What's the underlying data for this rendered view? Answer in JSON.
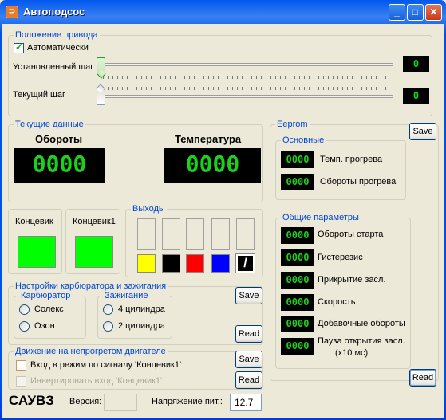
{
  "window": {
    "title": "Автоподсос",
    "app_icon": "pump-icon"
  },
  "titlebar_buttons": {
    "minimize": "_",
    "maximize": "□",
    "close": "✕"
  },
  "drive": {
    "legend": "Положение привода",
    "auto_label": "Автоматически",
    "auto_checked": true,
    "set_step_label": "Установленный шаг",
    "set_step_value": "0",
    "current_step_label": "Текущий шаг",
    "current_step_value": "0"
  },
  "current_data": {
    "legend": "Текущие данные",
    "rpm_label": "Обороты",
    "rpm_value": "0000",
    "temp_label": "Температура",
    "temp_value": "0000"
  },
  "limit_switch": {
    "label": "Концевик",
    "color": "#00ff00"
  },
  "limit_switch1": {
    "label": "Концевик1",
    "color": "#00ff00"
  },
  "outputs": {
    "legend": "Выходы",
    "colors": [
      "#ffff00",
      "#000000",
      "#ff0000",
      "#0000ff",
      "#000000"
    ],
    "last_symbol": "/"
  },
  "carb": {
    "legend": "Настройки карбюратора и зажигания",
    "carb_legend": "Карбюратор",
    "carb_options": [
      "Солекс",
      "Озон"
    ],
    "ign_legend": "Зажигание",
    "ign_options": [
      "4 цилиндра",
      "2 цилиндра"
    ],
    "save_label": "Save",
    "read_label": "Read"
  },
  "cold": {
    "legend": "Движение на непрогретом двигателе",
    "enter_mode_label": "Вход в режим по сигналу 'Концевик1'",
    "invert_label": "Инвертировать вход 'Концевик1'",
    "save_label": "Save",
    "read_label": "Read"
  },
  "eeprom": {
    "legend": "Eeprom",
    "save_label": "Save",
    "read_label": "Read",
    "main_legend": "Основные",
    "main_params": [
      {
        "value": "0000",
        "label": "Темп. прогрева"
      },
      {
        "value": "0000",
        "label": "Обороты прогрева"
      }
    ],
    "general_legend": "Общие параметры",
    "general_params": [
      {
        "value": "0000",
        "label": "Обороты старта"
      },
      {
        "value": "0000",
        "label": "Гистерезис"
      },
      {
        "value": "0000",
        "label": "Прикрытие засл."
      },
      {
        "value": "0000",
        "label": "Скорость"
      },
      {
        "value": "0000",
        "label": "Добавочные обороты"
      },
      {
        "value": "0000",
        "label": "Пауза открытия засл.",
        "label2": "(x10 мс)"
      }
    ]
  },
  "footer": {
    "brand": "САУВЗ",
    "version_label": "Версия:",
    "version_value": "",
    "voltage_label": "Напряжение пит.:",
    "voltage_value": "12.7"
  }
}
